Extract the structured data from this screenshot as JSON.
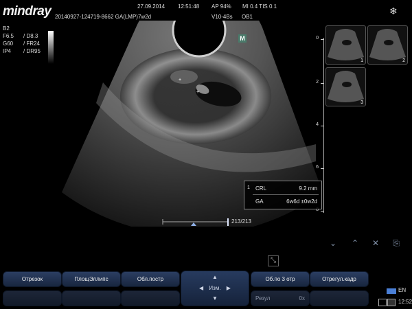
{
  "header": {
    "brand": "mindray",
    "date": "27.09.2014",
    "time": "12:51:48",
    "ap": "AP  94%",
    "mi_tis": "MI 0.4  TIS 0.1",
    "patient_id": "20140927-124719-8662 GA(LMP)7w2d",
    "probe": "V10-4Bs",
    "exam": "OB1"
  },
  "params": [
    {
      "a": "B2",
      "b": ""
    },
    {
      "a": "F6.5",
      "b": "/ D8.3"
    },
    {
      "a": "G60",
      "b": "/ FR24"
    },
    {
      "a": "IP4",
      "b": "/ DR95"
    }
  ],
  "depth_scale": [
    {
      "label": "0"
    },
    {
      "label": "2"
    },
    {
      "label": "4"
    },
    {
      "label": "6"
    },
    {
      "label": "8"
    }
  ],
  "thumbnails": [
    {
      "num": "1"
    },
    {
      "num": "2"
    },
    {
      "num": "3"
    }
  ],
  "measurement": {
    "rows": [
      {
        "num": "1",
        "key": "CRL",
        "value": "9.2 mm"
      },
      {
        "num": "",
        "key": "GA",
        "value": "6w6d ±0w2d"
      }
    ]
  },
  "cine": {
    "frame": "213/213",
    "position_fraction": 1.0
  },
  "marker": "M",
  "softkeys_top": [
    "Отрезок",
    "ПлощЭллипс",
    "Обл.постр",
    "Об.по 3 отр",
    "Отрегул.кадр"
  ],
  "softkeys_bottom": [
    "",
    "",
    "",
    "Резул",
    ""
  ],
  "softkey_bottom_right": "0x",
  "center_control": {
    "label": "Изм."
  },
  "tray": {
    "lang": "EN",
    "clock": "12:52"
  },
  "colors": {
    "softkey": "#233658",
    "background": "#000000"
  }
}
